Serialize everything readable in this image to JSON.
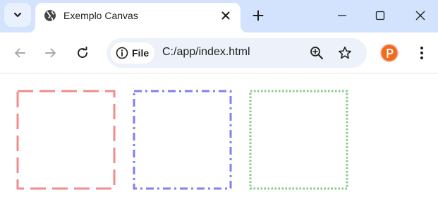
{
  "browser": {
    "tab": {
      "title": "Exemplo Canvas",
      "favicon": "globe-icon"
    },
    "address_bar": {
      "chip_label": "File",
      "chip_icon": "info-icon",
      "url": "C:/app/index.html"
    },
    "profile": {
      "icon": "profile-avatar",
      "color": "#f26b1d"
    },
    "accent_color": "#d3e3fd"
  },
  "canvas": {
    "squares": [
      {
        "name": "red-dashed-square",
        "stroke": "#f28c8c",
        "style": "dashed"
      },
      {
        "name": "blue-dash-dot-square",
        "stroke": "#8080f0",
        "style": "dash-dot"
      },
      {
        "name": "green-dotted-square",
        "stroke": "#86c986",
        "style": "dotted"
      }
    ]
  }
}
